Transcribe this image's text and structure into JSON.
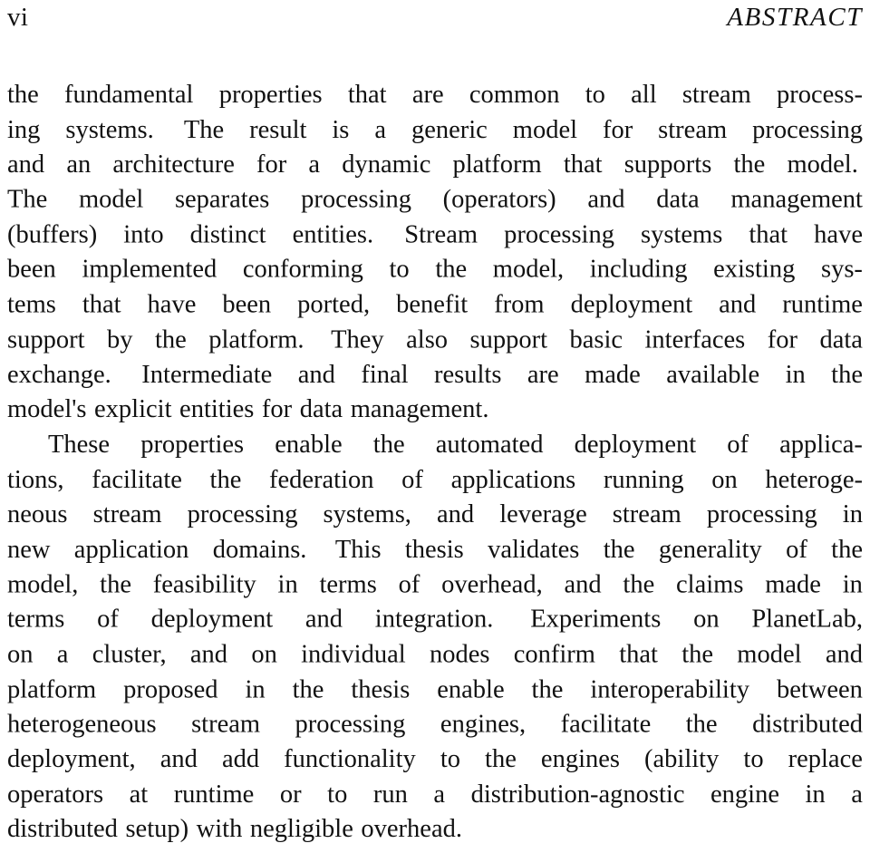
{
  "page": {
    "background_color": "#ffffff",
    "text_color": "#111111",
    "folio": "vi",
    "running_title": "ABSTRACT"
  },
  "body": {
    "paragraphs": [
      {
        "indent_first_line": false,
        "text": "the fundamental properties that are common to all stream processing systems. The result is a generic model for stream processing and an architecture for a dynamic platform that supports the model. The model separates processing (operators) and data management (buffers) into distinct entities. Stream processing systems that have been implemented conforming to the model, including existing systems that have been ported, benefit from deployment and runtime support by the platform. They also support basic interfaces for data exchange. Intermediate and final results are made available in the model's explicit entities for data management."
      },
      {
        "indent_first_line": true,
        "text": "These properties enable the automated deployment of applications, facilitate the federation of applications running on heterogeneous stream processing systems, and leverage stream processing in new application domains. This thesis validates the generality of the model, the feasibility in terms of overhead, and the claims made in terms of deployment and integration. Experiments on PlanetLab, on a cluster, and on individual nodes confirm that the model and platform proposed in the thesis enable the interoperability between heterogeneous stream processing engines, facilitate the distributed deployment, and add functionality to the engines (ability to replace operators at runtime or to run a distribution-agnostic engine in a distributed setup) with negligible overhead."
      }
    ],
    "lines": [
      {
        "justify": true,
        "indent": false,
        "words": [
          "the",
          "fundamental",
          "properties",
          "that",
          "are",
          "common",
          "to",
          "all",
          "stream",
          "process-"
        ]
      },
      {
        "justify": true,
        "indent": false,
        "words": [
          "ing",
          "systems.",
          "The",
          "result",
          "is",
          "a",
          "generic",
          "model",
          "for",
          "stream",
          "processing"
        ]
      },
      {
        "justify": true,
        "indent": false,
        "words": [
          "and",
          "an",
          "architecture",
          "for",
          "a",
          "dynamic",
          "platform",
          "that",
          "supports",
          "the",
          "model."
        ]
      },
      {
        "justify": true,
        "indent": false,
        "words": [
          "The",
          "model",
          "separates",
          "processing",
          "(operators)",
          "and",
          "data",
          "management"
        ]
      },
      {
        "justify": true,
        "indent": false,
        "words": [
          "(buffers)",
          "into",
          "distinct",
          "entities.",
          "Stream",
          "processing",
          "systems",
          "that",
          "have"
        ]
      },
      {
        "justify": true,
        "indent": false,
        "words": [
          "been",
          "implemented",
          "conforming",
          "to",
          "the",
          "model,",
          "including",
          "existing",
          "sys-"
        ]
      },
      {
        "justify": true,
        "indent": false,
        "words": [
          "tems",
          "that",
          "have",
          "been",
          "ported,",
          "benefit",
          "from",
          "deployment",
          "and",
          "runtime"
        ]
      },
      {
        "justify": true,
        "indent": false,
        "words": [
          "support",
          "by",
          "the",
          "platform.",
          "They",
          "also",
          "support",
          "basic",
          "interfaces",
          "for",
          "data"
        ]
      },
      {
        "justify": true,
        "indent": false,
        "words": [
          "exchange.",
          "Intermediate",
          "and",
          "final",
          "results",
          "are",
          "made",
          "available",
          "in",
          "the"
        ]
      },
      {
        "justify": false,
        "indent": false,
        "words": [
          "model's",
          "explicit",
          "entities",
          "for",
          "data",
          "management."
        ]
      },
      {
        "justify": true,
        "indent": true,
        "words": [
          "These",
          "properties",
          "enable",
          "the",
          "automated",
          "deployment",
          "of",
          "applica-"
        ]
      },
      {
        "justify": true,
        "indent": false,
        "words": [
          "tions,",
          "facilitate",
          "the",
          "federation",
          "of",
          "applications",
          "running",
          "on",
          "heteroge-"
        ]
      },
      {
        "justify": true,
        "indent": false,
        "words": [
          "neous",
          "stream",
          "processing",
          "systems,",
          "and",
          "leverage",
          "stream",
          "processing",
          "in"
        ]
      },
      {
        "justify": true,
        "indent": false,
        "words": [
          "new",
          "application",
          "domains.",
          "This",
          "thesis",
          "validates",
          "the",
          "generality",
          "of",
          "the"
        ]
      },
      {
        "justify": true,
        "indent": false,
        "words": [
          "model,",
          "the",
          "feasibility",
          "in",
          "terms",
          "of",
          "overhead,",
          "and",
          "the",
          "claims",
          "made",
          "in"
        ]
      },
      {
        "justify": true,
        "indent": false,
        "words": [
          "terms",
          "of",
          "deployment",
          "and",
          "integration.",
          "Experiments",
          "on",
          "PlanetLab,"
        ]
      },
      {
        "justify": true,
        "indent": false,
        "words": [
          "on",
          "a",
          "cluster,",
          "and",
          "on",
          "individual",
          "nodes",
          "confirm",
          "that",
          "the",
          "model",
          "and"
        ]
      },
      {
        "justify": true,
        "indent": false,
        "words": [
          "platform",
          "proposed",
          "in",
          "the",
          "thesis",
          "enable",
          "the",
          "interoperability",
          "between"
        ]
      },
      {
        "justify": true,
        "indent": false,
        "words": [
          "heterogeneous",
          "stream",
          "processing",
          "engines,",
          "facilitate",
          "the",
          "distributed"
        ]
      },
      {
        "justify": true,
        "indent": false,
        "words": [
          "deployment,",
          "and",
          "add",
          "functionality",
          "to",
          "the",
          "engines",
          "(ability",
          "to",
          "replace"
        ]
      },
      {
        "justify": true,
        "indent": false,
        "words": [
          "operators",
          "at",
          "runtime",
          "or",
          "to",
          "run",
          "a",
          "distribution-agnostic",
          "engine",
          "in",
          "a"
        ]
      },
      {
        "justify": false,
        "indent": false,
        "words": [
          "distributed",
          "setup)",
          "with",
          "negligible",
          "overhead."
        ]
      }
    ]
  }
}
